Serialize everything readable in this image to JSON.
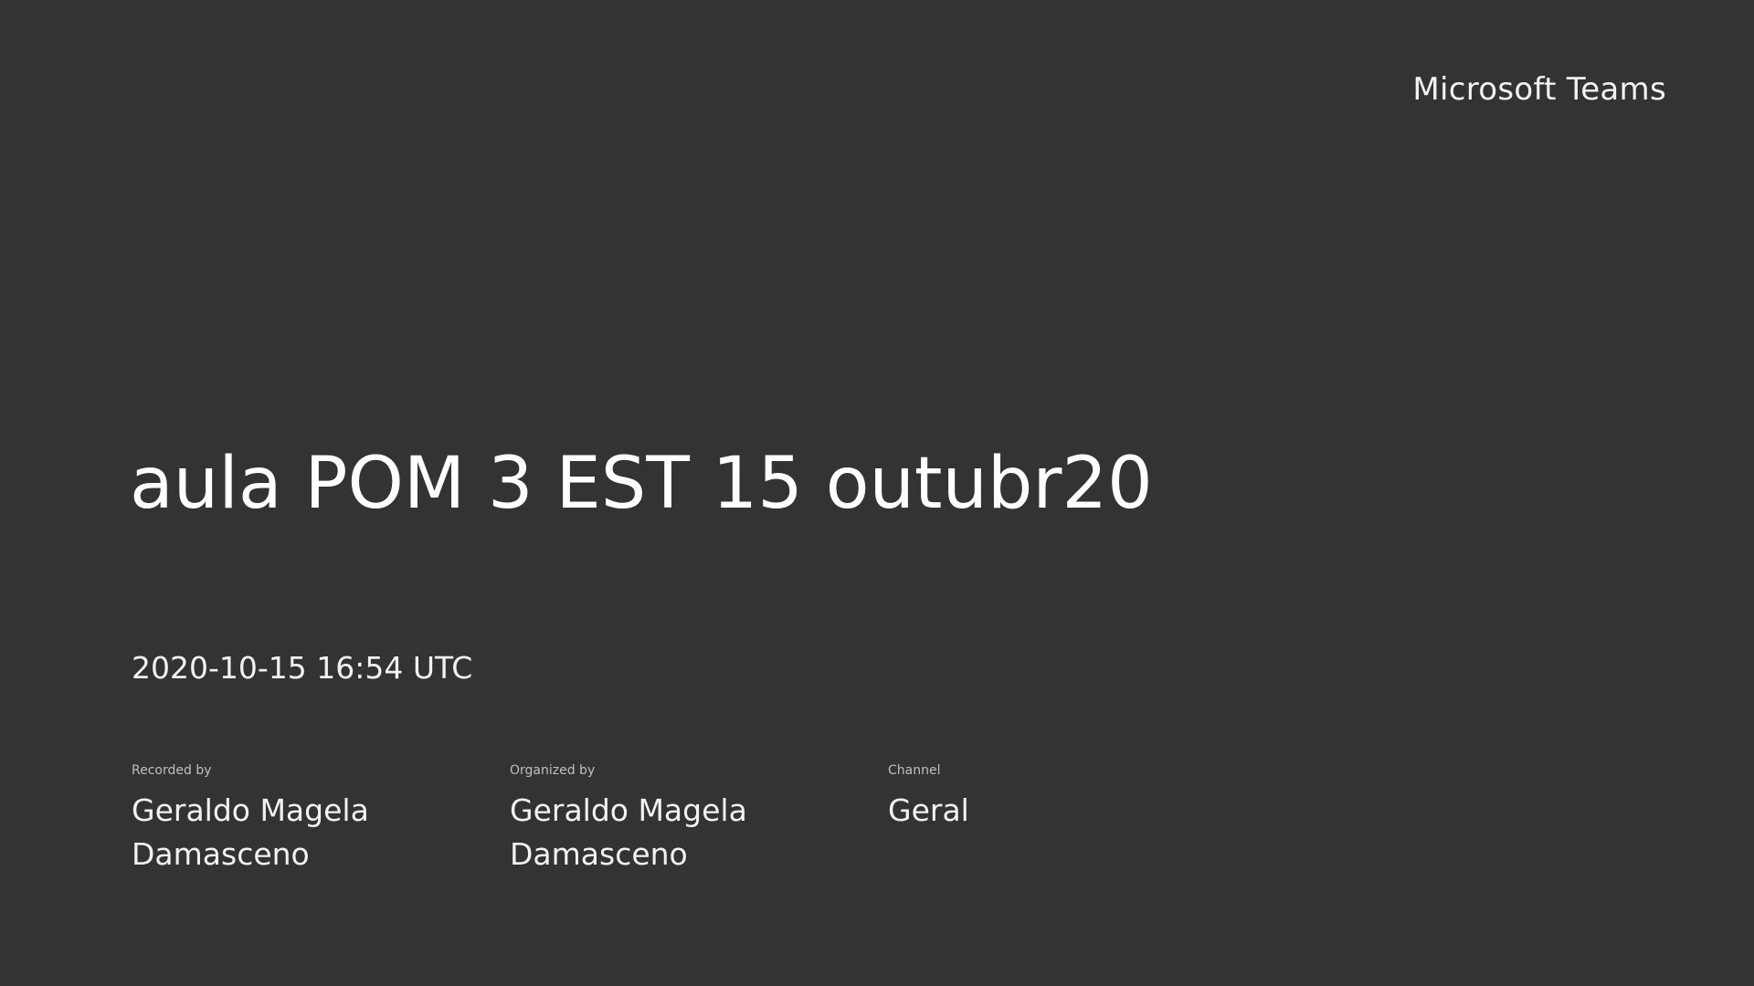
{
  "brand": "Microsoft Teams",
  "recording": {
    "title": "aula POM 3 EST 15 outubr20",
    "datetime": "2020-10-15 16:54 UTC"
  },
  "meta": {
    "recorded_by": {
      "label": "Recorded by",
      "value": "Geraldo Magela Damasceno"
    },
    "organized_by": {
      "label": "Organized by",
      "value": "Geraldo Magela Damasceno"
    },
    "channel": {
      "label": "Channel",
      "value": "Geral"
    }
  }
}
